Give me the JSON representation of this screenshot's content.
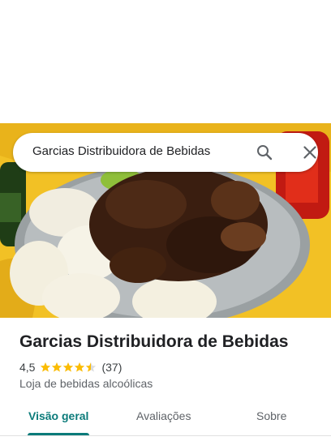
{
  "search": {
    "query": "Garcias Distribuidora de Bebidas"
  },
  "place": {
    "title": "Garcias Distribuidora de Bebidas",
    "rating": "4,5",
    "rating_value": 4.5,
    "stars_max": 5,
    "review_count": "(37)",
    "category": "Loja de bebidas alcoólicas"
  },
  "tabs": [
    {
      "label": "Visão geral",
      "active": true
    },
    {
      "label": "Avaliações",
      "active": false
    },
    {
      "label": "Sobre",
      "active": false
    }
  ],
  "colors": {
    "accent": "#0b7b7a",
    "star": "#fbbc04",
    "star_empty": "#dadce0"
  },
  "icons": {
    "search": "search-icon",
    "close": "close-icon"
  }
}
